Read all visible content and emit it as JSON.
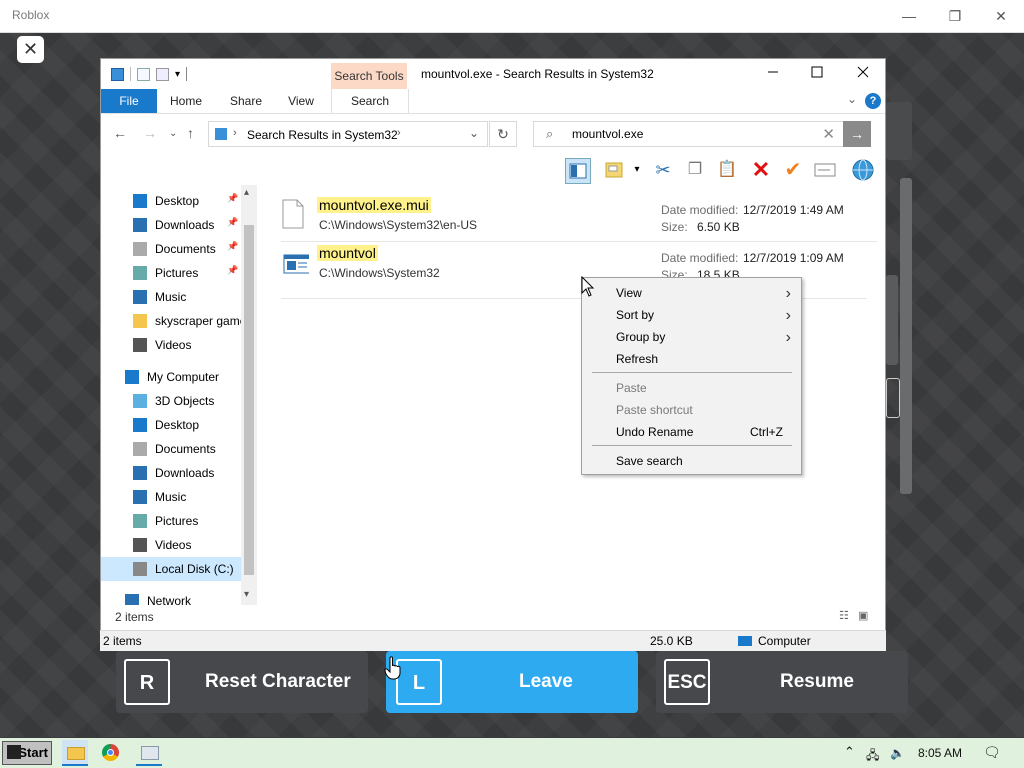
{
  "roblox": {
    "title": "Roblox",
    "close_x": "✕",
    "min": "—",
    "restore": "❐",
    "close": "✕"
  },
  "explorer": {
    "search_tools_tab": "Search Tools",
    "window_title": "mountvol.exe - Search Results in System32",
    "tabs": [
      "File",
      "Home",
      "Share",
      "View",
      "Search"
    ],
    "address": "Search Results in System32",
    "search_value": "mountvol.exe",
    "nav_items": [
      {
        "label": "Desktop",
        "icon": "desktop-icon",
        "pinned": true
      },
      {
        "label": "Downloads",
        "icon": "downloads-icon",
        "pinned": true
      },
      {
        "label": "Documents",
        "icon": "documents-icon",
        "pinned": true
      },
      {
        "label": "Pictures",
        "icon": "pictures-icon",
        "pinned": true
      },
      {
        "label": "Music",
        "icon": "music-icon",
        "pinned": false
      },
      {
        "label": "skyscraper game",
        "icon": "folder-icon",
        "pinned": false
      },
      {
        "label": "Videos",
        "icon": "videos-icon",
        "pinned": false
      },
      {
        "label": "My Computer",
        "icon": "computer-icon",
        "pinned": false
      },
      {
        "label": "3D Objects",
        "icon": "3d-objects-icon",
        "pinned": false
      },
      {
        "label": "Desktop",
        "icon": "desktop-icon",
        "pinned": false
      },
      {
        "label": "Documents",
        "icon": "documents-icon",
        "pinned": false
      },
      {
        "label": "Downloads",
        "icon": "downloads-icon",
        "pinned": false
      },
      {
        "label": "Music",
        "icon": "music-icon",
        "pinned": false
      },
      {
        "label": "Pictures",
        "icon": "pictures-icon",
        "pinned": false
      },
      {
        "label": "Videos",
        "icon": "videos-icon",
        "pinned": false
      },
      {
        "label": "Local Disk (C:)",
        "icon": "drive-icon",
        "pinned": false
      },
      {
        "label": "Network",
        "icon": "network-icon",
        "pinned": false
      }
    ],
    "files": [
      {
        "name": "mountvol.exe.mui",
        "path": "C:\\Windows\\System32\\en-US",
        "date_label": "Date modified:",
        "date_value": "12/7/2019 1:49 AM",
        "size_label": "Size:",
        "size_value": "6.50 KB"
      },
      {
        "name": "mountvol",
        "path": "C:\\Windows\\System32",
        "date_label": "Date modified:",
        "date_value": "12/7/2019 1:09 AM",
        "size_label": "Size:",
        "size_value": "18.5 KB"
      }
    ],
    "items_count": "2 items",
    "status": {
      "items": "2 items",
      "size": "25.0 KB",
      "location": "Computer"
    }
  },
  "context_menu": {
    "items": [
      {
        "label": "View",
        "submenu": true,
        "disabled": false
      },
      {
        "label": "Sort by",
        "submenu": true,
        "disabled": false
      },
      {
        "label": "Group by",
        "submenu": true,
        "disabled": false
      },
      {
        "label": "Refresh",
        "submenu": false,
        "disabled": false
      },
      {
        "label": "Paste",
        "submenu": false,
        "disabled": true
      },
      {
        "label": "Paste shortcut",
        "submenu": false,
        "disabled": true
      },
      {
        "label": "Undo Rename",
        "submenu": false,
        "disabled": false,
        "shortcut": "Ctrl+Z"
      },
      {
        "label": "Save search",
        "submenu": false,
        "disabled": false
      }
    ]
  },
  "roblox_menu": {
    "reset": {
      "key": "R",
      "label": "Reset Character"
    },
    "leave": {
      "key": "L",
      "label": "Leave"
    },
    "resume": {
      "key": "ESC",
      "label": "Resume"
    }
  },
  "taskbar": {
    "start": "Start",
    "time": "8:05 AM"
  },
  "colors": {
    "accent": "#1979ca",
    "leave_button": "#2eaaf0",
    "dark_button": "#46484c",
    "highlight": "#fff28a",
    "search_tools": "#fcd9c7"
  }
}
